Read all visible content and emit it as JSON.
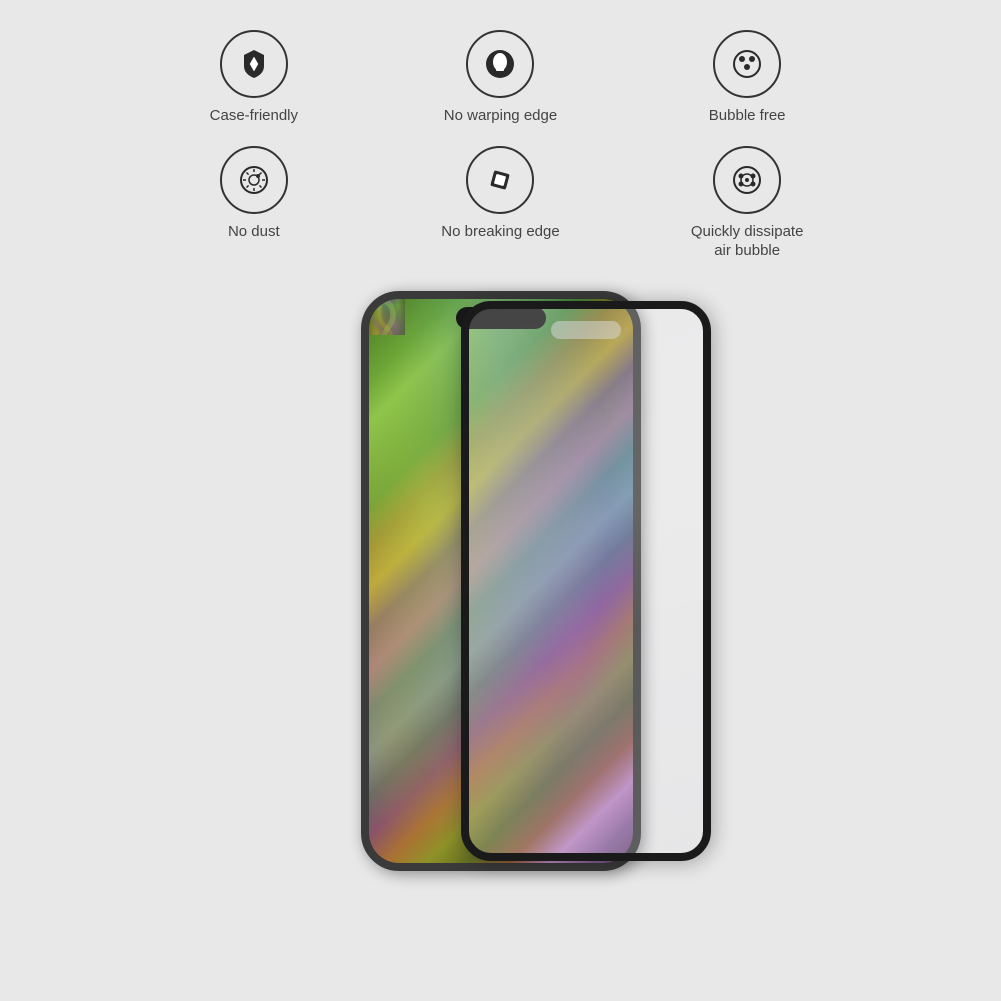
{
  "features": [
    {
      "id": "case-friendly",
      "label": "Case-friendly",
      "icon_type": "shield-diamond"
    },
    {
      "id": "no-warping-edge",
      "label": "No warping edge",
      "icon_type": "shield-filled"
    },
    {
      "id": "bubble-free",
      "label": "Bubble free",
      "icon_type": "dots-circle"
    },
    {
      "id": "no-dust",
      "label": "No dust",
      "icon_type": "sun-circle"
    },
    {
      "id": "no-breaking-edge",
      "label": "No breaking edge",
      "icon_type": "diamond-tilt"
    },
    {
      "id": "quickly-dissipate",
      "label": "Quickly dissipate\nair bubble",
      "icon_type": "crosshair-dots"
    }
  ],
  "bg_color": "#e8e8e8",
  "icon_border_color": "#333333",
  "text_color": "#444444"
}
